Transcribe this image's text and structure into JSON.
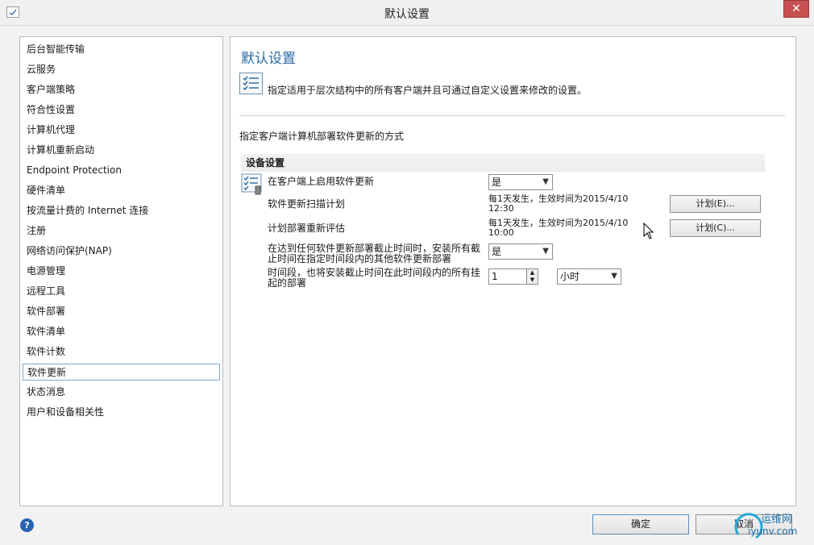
{
  "window": {
    "title": "默认设置",
    "close_label": "✕"
  },
  "nav": {
    "items": [
      "后台智能传输",
      "云服务",
      "客户端策略",
      "符合性设置",
      "计算机代理",
      "计算机重新启动",
      "Endpoint Protection",
      "硬件清单",
      "按流量计费的 Internet 连接",
      "注册",
      "网络访问保护(NAP)",
      "电源管理",
      "远程工具",
      "软件部署",
      "软件清单",
      "软件计数",
      "软件更新",
      "状态消息",
      "用户和设备相关性"
    ],
    "selected": "软件更新"
  },
  "main": {
    "heading": "默认设置",
    "description": "指定适用于层次结构中的所有客户端并且可通过自定义设置来修改的设置。",
    "subheading": "指定客户端计算机部署软件更新的方式",
    "group_title": "设备设置",
    "rows": {
      "enable_label": "在客户端上启用软件更新",
      "enable_value": "是",
      "scan_label": "软件更新扫描计划",
      "scan_schedule_line1": "每1天发生，生效时间为2015/4/10",
      "scan_schedule_line2": "12:30",
      "scan_button": "计划(E)...",
      "reeval_label": "计划部署重新评估",
      "reeval_schedule_line1": "每1天发生，生效时间为2015/4/10",
      "reeval_schedule_line2": "10:00",
      "reeval_button": "计划(C)...",
      "deadline_label_line1": "在达到任何软件更新部署截止时间时，安装所有截",
      "deadline_label_line2": "止时间在指定时间段内的其他软件更新部署",
      "deadline_value": "是",
      "period_label_line1": "时间段，也将安装截止时间在此时间段内的所有挂",
      "period_label_line2": "起的部署",
      "period_value": "1",
      "period_unit": "小时"
    }
  },
  "footer": {
    "help": "?",
    "ok": "确定",
    "cancel": "取消"
  },
  "watermark": {
    "line1": "运维网",
    "line2": "iyunv.com"
  },
  "colors": {
    "accent": "#2b6ca3",
    "selection_border": "#7ea7c9",
    "close_red": "#c75050"
  }
}
